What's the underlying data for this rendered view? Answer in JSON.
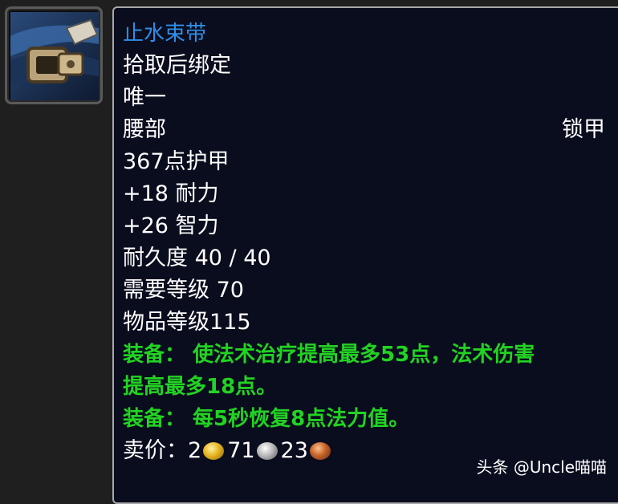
{
  "item": {
    "name": "止水束带",
    "bind": "拾取后绑定",
    "unique": "唯一",
    "slot": "腰部",
    "armor_type": "锁甲",
    "armor": "367点护甲",
    "stat1": "+18 耐力",
    "stat2": "+26 智力",
    "durability": "耐久度 40 / 40",
    "req_level": "需要等级 70",
    "item_level": "物品等级115",
    "equip1_line1": "装备： 使法术治疗提高最多53点，法术伤害",
    "equip1_line2": "提高最多18点。",
    "equip2": "装备： 每5秒恢复8点法力值。",
    "sell_label": "卖价：",
    "sell_gold": "2",
    "sell_silver": "71",
    "sell_copper": "23"
  },
  "watermark": "头条 @Uncle喵喵",
  "colors": {
    "item_name": "#2f8fe8",
    "equip_text": "#22d322",
    "tooltip_bg": "#0a0d1e"
  },
  "icons": {
    "item_icon": "belt-icon",
    "gold": "gold-coin-icon",
    "silver": "silver-coin-icon",
    "copper": "copper-coin-icon"
  }
}
